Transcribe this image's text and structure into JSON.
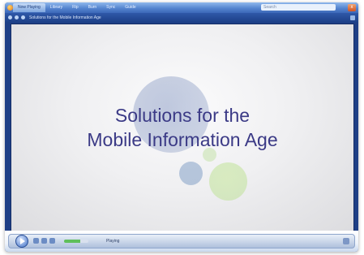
{
  "window": {
    "title": "Windows Media Player",
    "tabs": [
      {
        "label": "Now Playing",
        "active": true
      },
      {
        "label": "Library",
        "active": false
      },
      {
        "label": "Rip",
        "active": false
      },
      {
        "label": "Burn",
        "active": false
      },
      {
        "label": "Sync",
        "active": false
      },
      {
        "label": "Guide",
        "active": false
      }
    ],
    "search_placeholder": "Search",
    "close_label": "x"
  },
  "address_bar": {
    "text": "Solutions for the Mobile Information Age"
  },
  "slide": {
    "line1": "Solutions for the",
    "line2": "Mobile Information Age",
    "text_color": "#3b3a86"
  },
  "controls": {
    "status": "Playing",
    "volume_level": 0.65,
    "accent_color": "#5fbf5a"
  }
}
